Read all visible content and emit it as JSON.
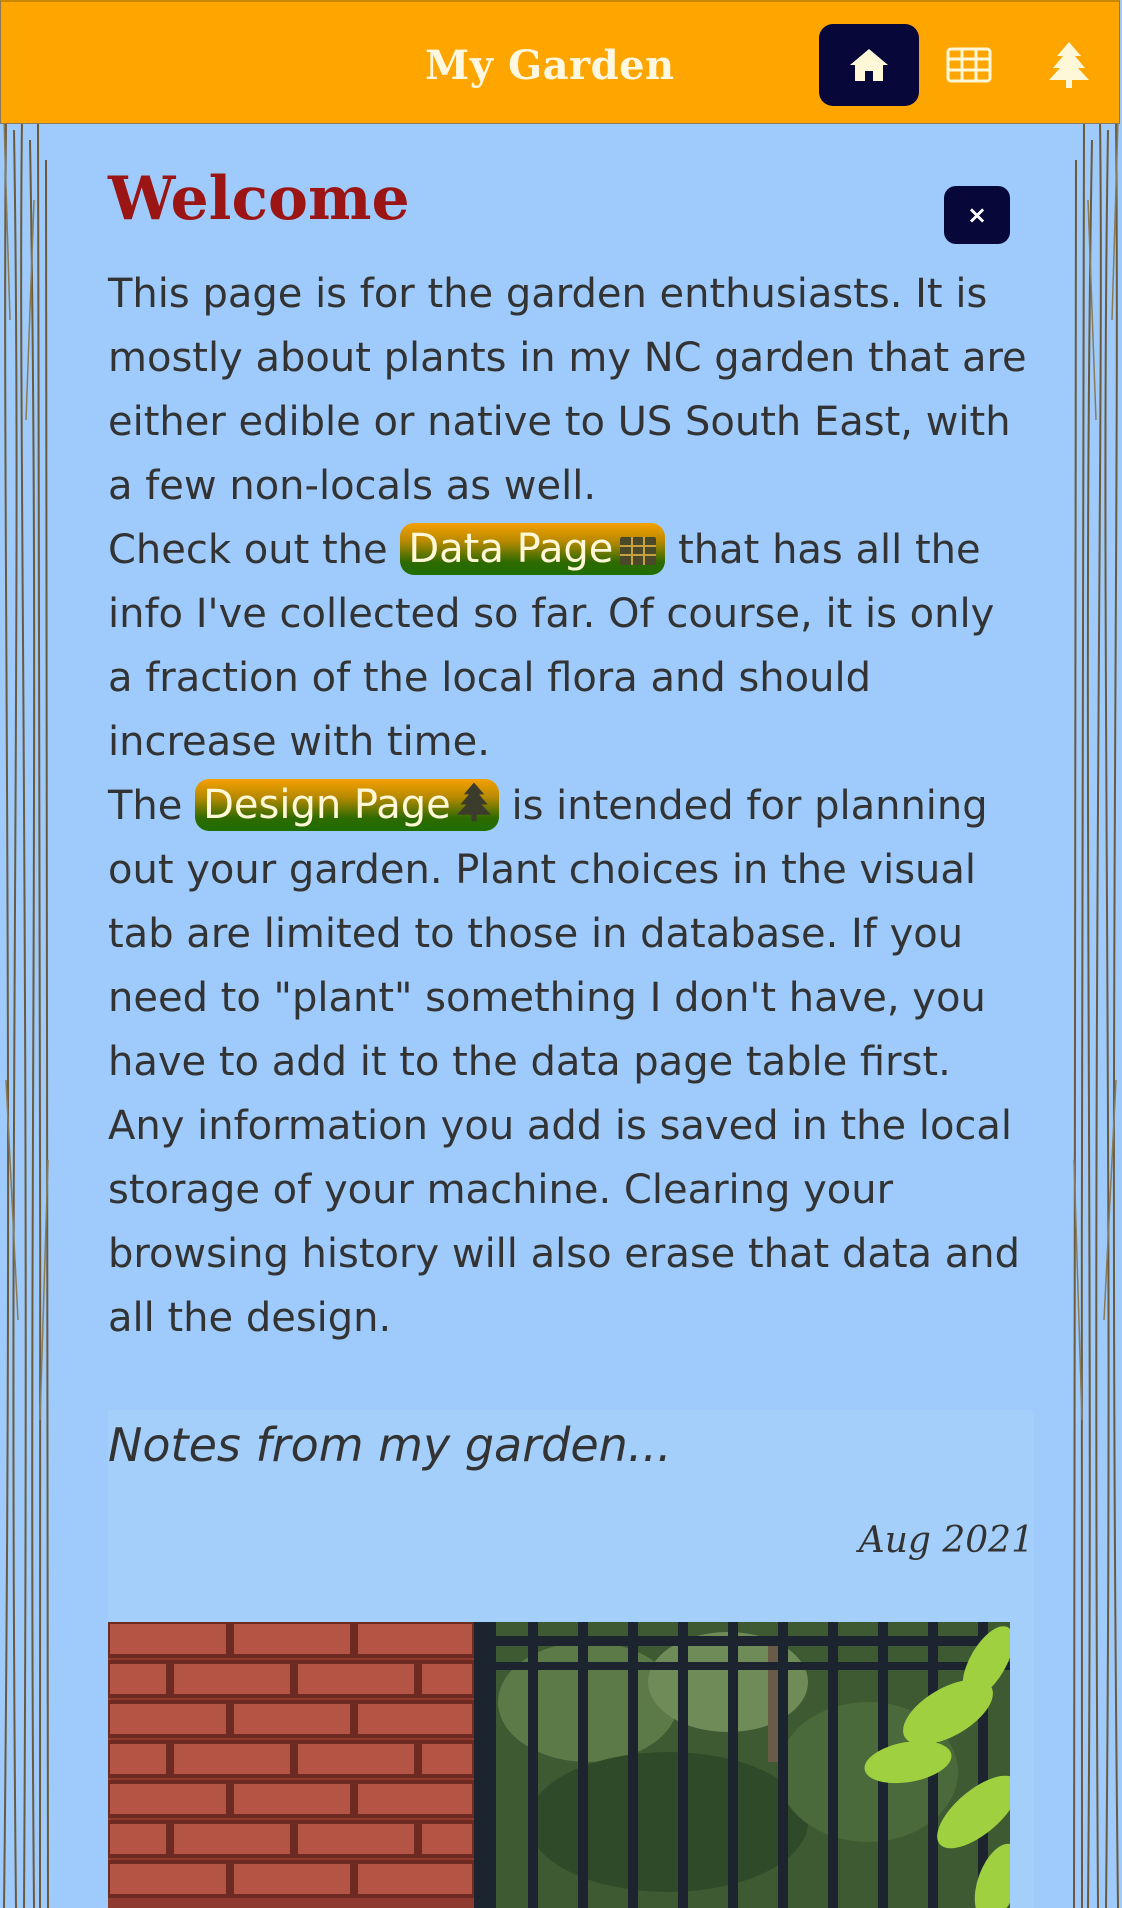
{
  "header": {
    "title": "My Garden",
    "nav": [
      {
        "name": "home",
        "icon": "home-icon",
        "active": true
      },
      {
        "name": "data",
        "icon": "table-icon",
        "active": false
      },
      {
        "name": "design",
        "icon": "tree-icon",
        "active": false
      }
    ]
  },
  "welcome": {
    "title": "Welcome",
    "close_label": "×",
    "p1": "This page is for the garden enthusiasts. It is mostly about plants in my NC garden that are either edible or native to US South East, with a few non-locals as well.",
    "p2_before": "Check out the ",
    "data_page_label": "Data Page",
    "p2_after": " that has all the info I've collected so far. Of course, it is only a fraction of the local flora and should increase with time.",
    "p3_before": "The ",
    "design_page_label": "Design Page",
    "p3_after": " is intended for planning out your garden. Plant choices in the visual tab are limited to those in database. If you need to \"plant\" something I don't have, you have to add it to the data page table first. Any information you add is saved in the local storage of your machine. Clearing your browsing history will also erase that data and all the design."
  },
  "notes": {
    "title": "Notes from my garden...",
    "date": "Aug 2021"
  },
  "colors": {
    "header_bg": "#fea500",
    "page_bg": "#9ecbfb",
    "active_nav": "#07073a",
    "welcome_title": "#9c1515"
  }
}
